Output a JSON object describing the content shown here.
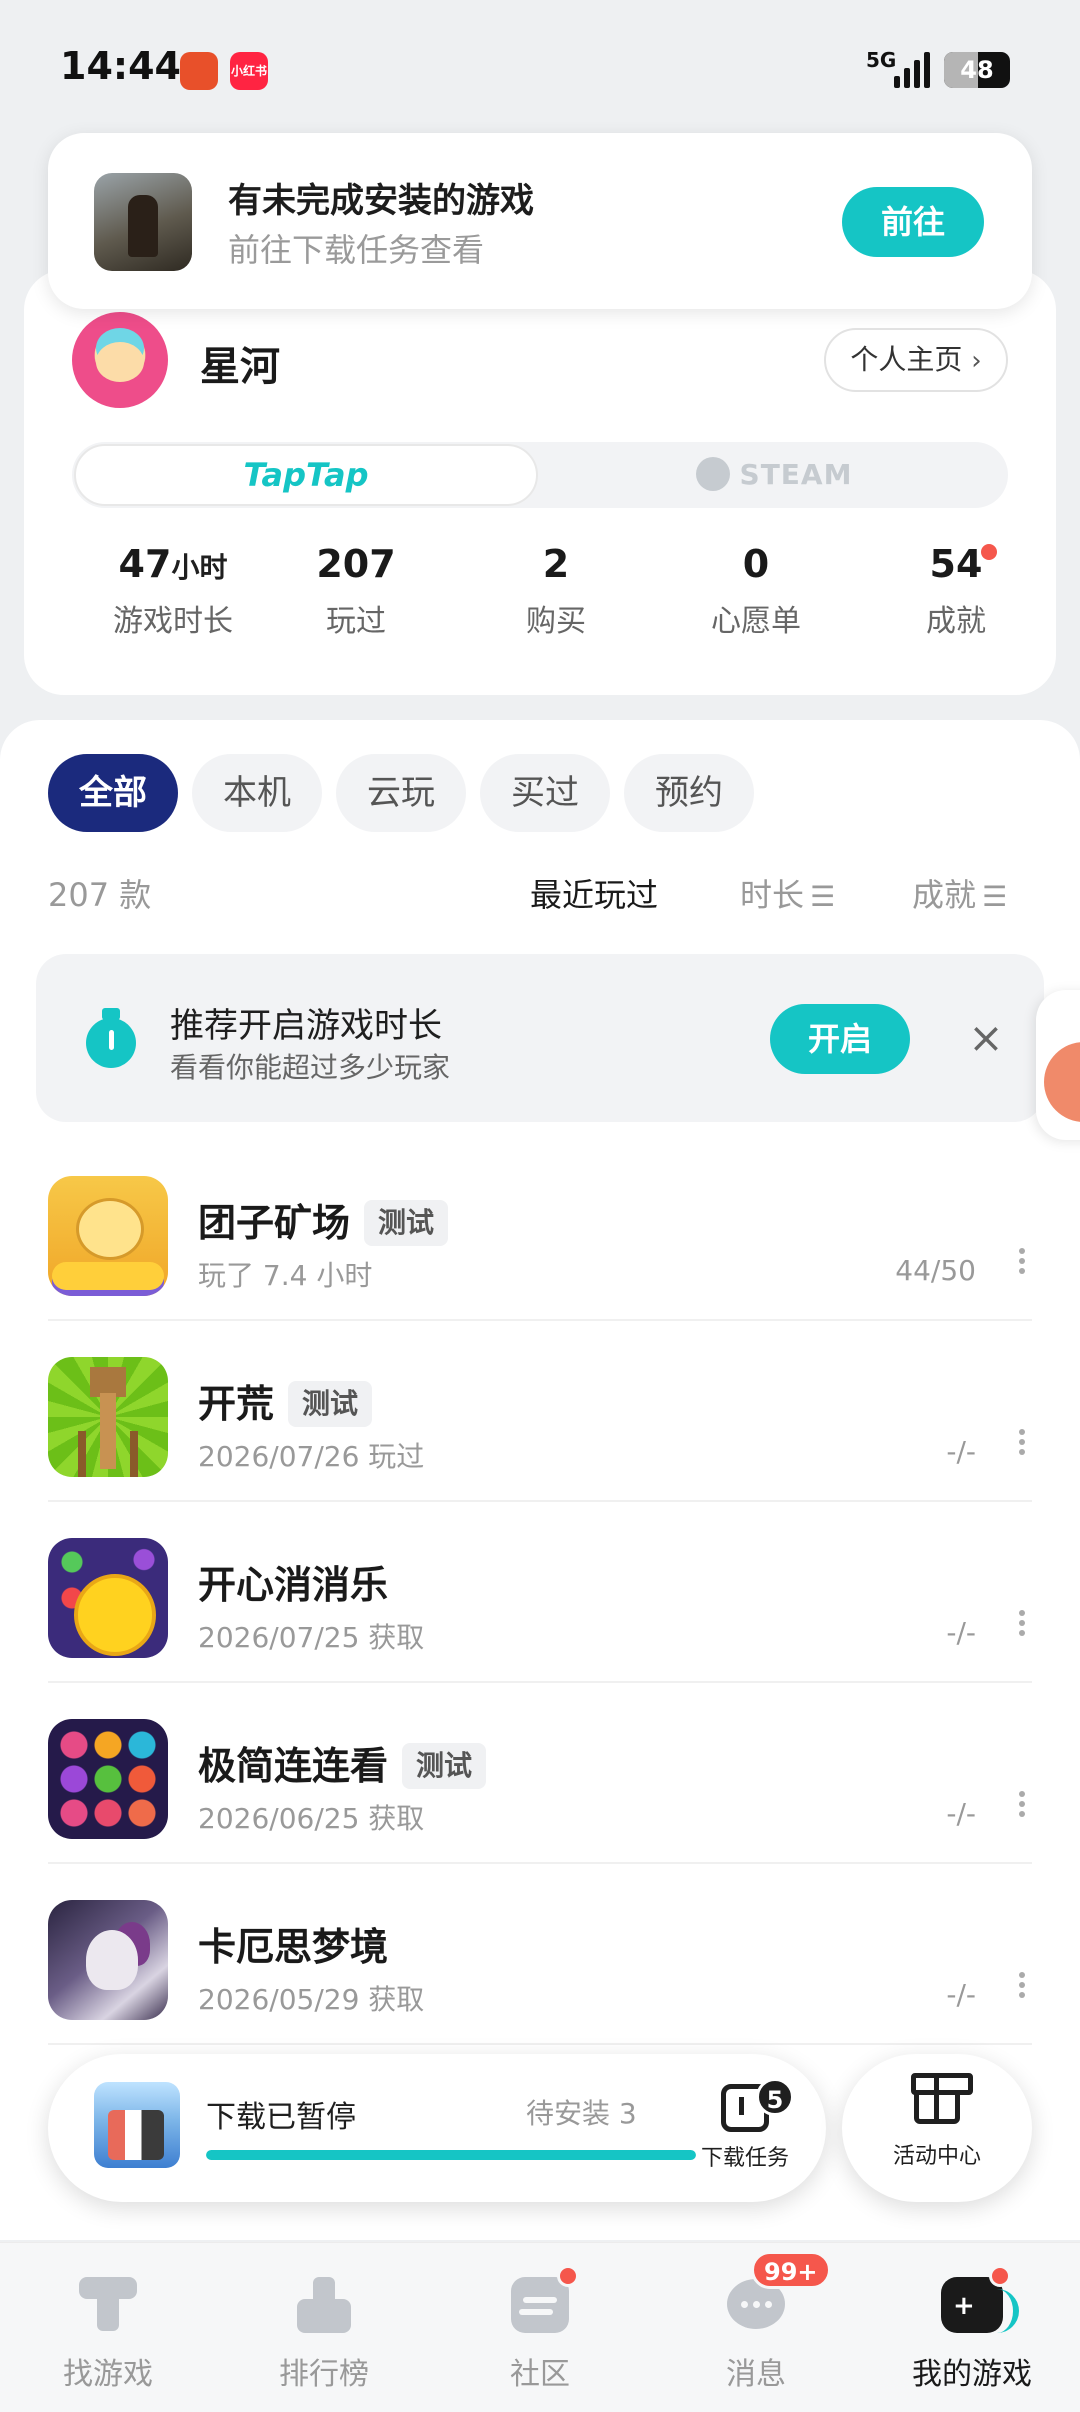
{
  "status_bar": {
    "time": "14:44",
    "app_icons": [
      "taobao-icon",
      "xiaohongshu-icon"
    ],
    "xiaohongshu_label": "小红书",
    "network": "5G",
    "battery": "48"
  },
  "banner": {
    "title": "有未完成安装的游戏",
    "subtitle": "前往下载任务查看",
    "button": "前往"
  },
  "profile": {
    "name": "星河",
    "profile_button": "个人主页",
    "platforms": {
      "taptap": "TapTap",
      "steam": "STEAM"
    },
    "stats": [
      {
        "value": "47",
        "unit": "小时",
        "label": "游戏时长"
      },
      {
        "value": "207",
        "unit": "",
        "label": "玩过"
      },
      {
        "value": "2",
        "unit": "",
        "label": "购买"
      },
      {
        "value": "0",
        "unit": "",
        "label": "心愿单"
      },
      {
        "value": "54",
        "unit": "",
        "label": "成就",
        "has_dot": true
      }
    ]
  },
  "filters": {
    "chips": [
      "全部",
      "本机",
      "云玩",
      "买过",
      "预约"
    ],
    "active": "全部"
  },
  "sort": {
    "count": "207 款",
    "options": [
      "最近玩过",
      "时长",
      "成就"
    ],
    "active": "最近玩过"
  },
  "recommend": {
    "title": "推荐开启游戏时长",
    "subtitle": "看看你能超过多少玩家",
    "button": "开启",
    "close": "×"
  },
  "games": [
    {
      "name": "团子矿场",
      "tag": "测试",
      "sub": "玩了 7.4 小时",
      "achievements": "44/50",
      "icon": "tuanzi"
    },
    {
      "name": "开荒",
      "tag": "测试",
      "sub": "2026/07/26 玩过",
      "achievements": "-/-",
      "icon": "kaihuang"
    },
    {
      "name": "开心消消乐",
      "tag": "",
      "sub": "2026/07/25 获取",
      "achievements": "-/-",
      "icon": "kaixin"
    },
    {
      "name": "极简连连看",
      "tag": "测试",
      "sub": "2026/06/25 获取",
      "achievements": "-/-",
      "icon": "jijian"
    },
    {
      "name": "卡厄思梦境",
      "tag": "",
      "sub": "2026/05/29 获取",
      "achievements": "-/-",
      "icon": "kaers"
    }
  ],
  "download": {
    "title": "下载已暂停",
    "pending": "待安装 3",
    "progress": 1.0,
    "task_label": "下载任务",
    "task_badge": "5"
  },
  "activity": {
    "label": "活动中心"
  },
  "bottom_nav": [
    {
      "label": "找游戏",
      "icon": "find-icon",
      "active": false
    },
    {
      "label": "排行榜",
      "icon": "rank-icon",
      "active": false
    },
    {
      "label": "社区",
      "icon": "community-icon",
      "active": false,
      "dot": true
    },
    {
      "label": "消息",
      "icon": "message-icon",
      "active": false,
      "badge": "99+"
    },
    {
      "label": "我的游戏",
      "icon": "my-games-icon",
      "active": true,
      "dot": true
    }
  ],
  "colors": {
    "accent": "#15c5c5",
    "chip_active": "#1b2a7d",
    "badge": "#f5574c"
  }
}
